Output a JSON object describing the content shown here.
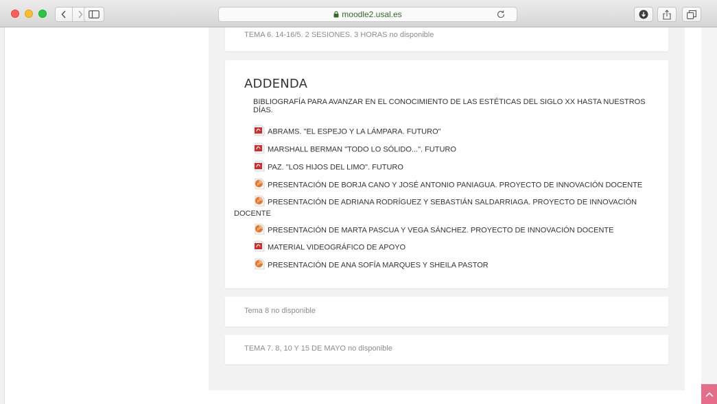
{
  "browser": {
    "url": "moodle2.usal.es",
    "icons": [
      "back-icon",
      "forward-icon",
      "sidebar-icon",
      "lock-icon",
      "reload-icon",
      "download-icon",
      "share-icon",
      "tabs-icon"
    ]
  },
  "sections": {
    "tema6": "TEMA 6. 14-16/5. 2 SESIONES. 3 HORAS no disponible",
    "addenda": {
      "title": "ADDENDA",
      "summary": "BIBLIOGRAFÍA PARA AVANZAR EN EL CONOCIMIENTO DE LAS ESTÉTICAS DEL SIGLO XX HASTA NUESTROS DÍAS.",
      "activities": [
        {
          "label": "ABRAMS. \"EL ESPEJO Y LA LÁMPARA. FUTURO\"",
          "icon": "pdf-icon"
        },
        {
          "label": "MARSHALL BERMAN \"TODO LO SÓLIDO...\". FUTURO",
          "icon": "pdf-icon"
        },
        {
          "label": "PAZ. \"LOS HIJOS DEL LIMO\". FUTURO",
          "icon": "pdf-icon"
        },
        {
          "label": "PRESENTACIÓN DE BORJA CANO Y JOSÉ ANTONIO PANIAGUA. PROYECTO DE INNOVACIÓN DOCENTE",
          "icon": "powerpoint-icon"
        },
        {
          "label": "PRESENTACIÓN DE ADRIANA RODRÍGUEZ Y SEBASTIÁN SALDARRIAGA. PROYECTO DE INNOVACIÓN DOCENTE",
          "icon": "powerpoint-icon"
        },
        {
          "label": "PRESENTACIÓN DE MARTA PASCUA Y VEGA SÁNCHEZ. PROYECTO DE INNOVACIÓN DOCENTE",
          "icon": "powerpoint-icon"
        },
        {
          "label": "MATERIAL VIDEOGRÁFICO DE APOYO",
          "icon": "pdf-icon"
        },
        {
          "label": "PRESENTACIÓN DE ANA SOFÍA MARQUES Y SHEILA PASTOR",
          "icon": "powerpoint-icon"
        }
      ]
    },
    "tema8": "Tema 8 no disponible",
    "tema7": "TEMA 7. 8, 10 Y 15 DE MAYO no disponible"
  },
  "colors": {
    "pdf_red": "#d42b2b",
    "ppt_orange": "#e8772c",
    "url_green": "#2f6d23",
    "back_to_top": "#e46e8a"
  }
}
